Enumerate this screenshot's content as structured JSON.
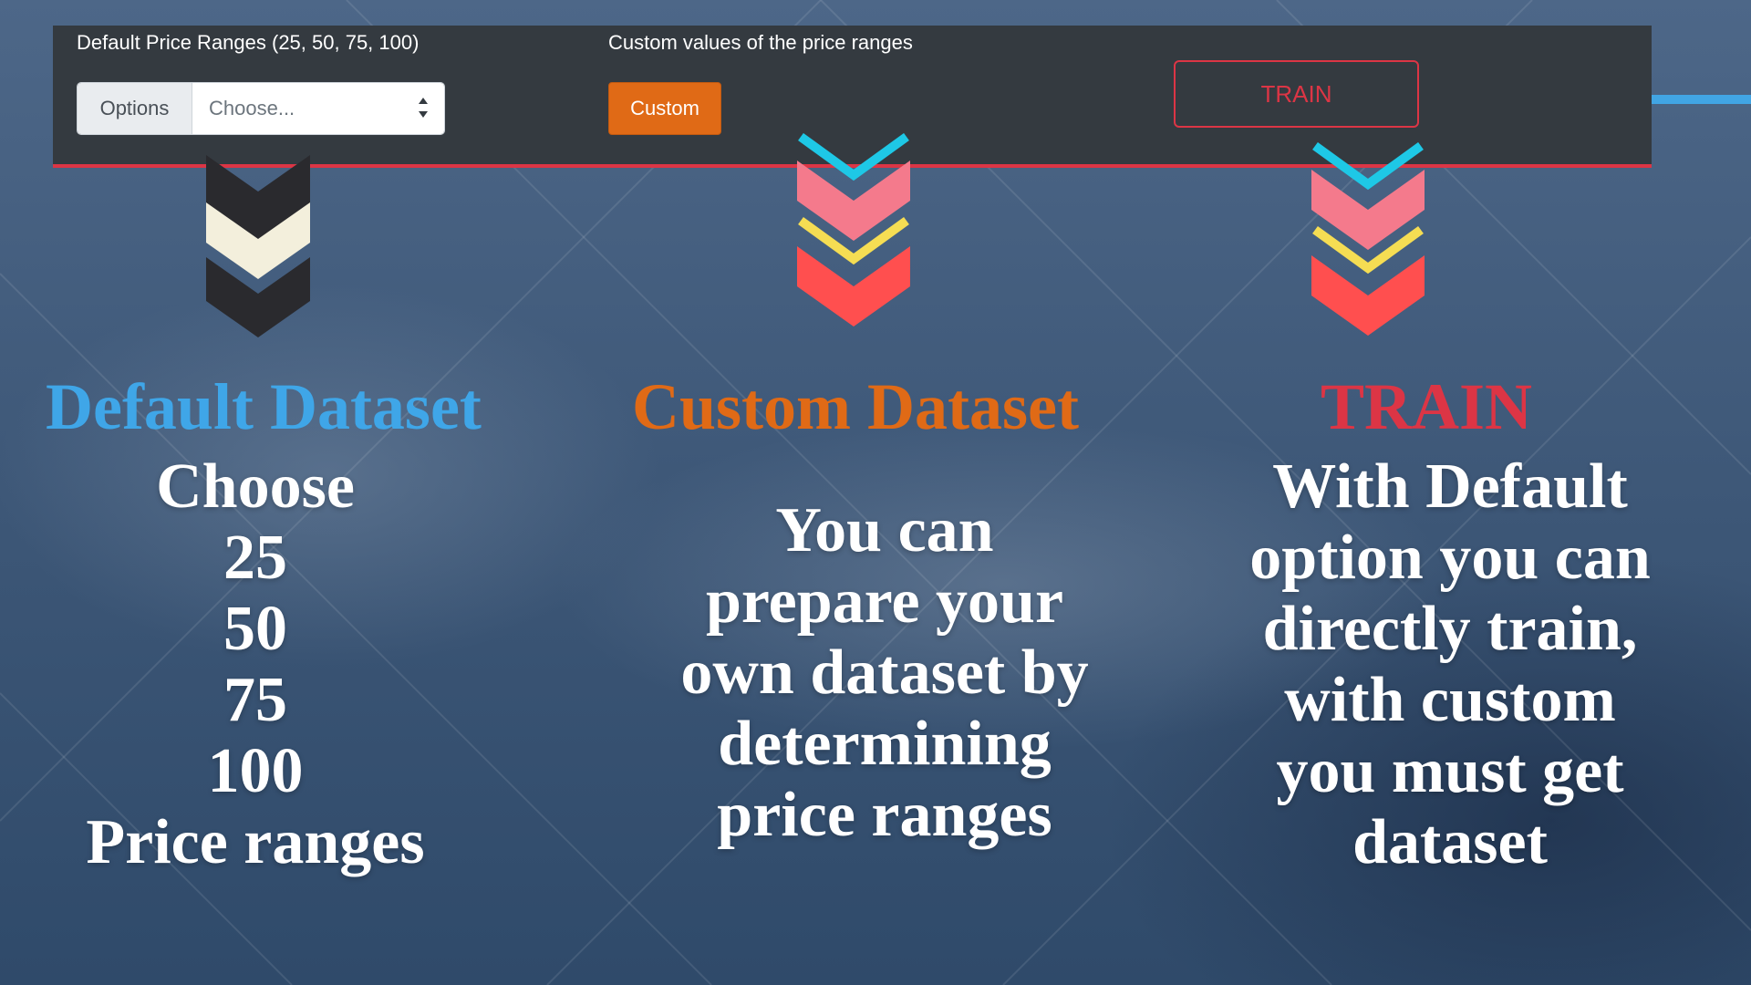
{
  "toolbar": {
    "default_label": "Default Price Ranges (25, 50, 75, 100)",
    "custom_label": "Custom values of the price ranges",
    "options_prepend": "Options",
    "select_value": "Choose...",
    "custom_button": "Custom",
    "train_button": "TRAIN"
  },
  "columns": {
    "default": {
      "heading": "Default Dataset",
      "lines": [
        "Choose",
        "25",
        "50",
        "75",
        "100",
        "Price ranges"
      ]
    },
    "custom": {
      "heading": "Custom Dataset",
      "lines": [
        "You can",
        "prepare your",
        "own dataset by",
        "determining",
        "price ranges"
      ]
    },
    "train": {
      "heading": "TRAIN",
      "lines": [
        "With Default",
        "option you can",
        "directly train,",
        "with custom",
        "you must get",
        "dataset"
      ]
    }
  },
  "colors": {
    "toolbar_bg": "#343a40",
    "danger": "#dc3545",
    "orange": "#e06a16",
    "blue": "#3fa6e8",
    "cyan": "#1ec8e6",
    "pink": "#f47a8c",
    "yellow": "#f5dd53",
    "coral": "#ff4f4f",
    "cream": "#f3efdc",
    "dark": "#2a2a2e"
  }
}
